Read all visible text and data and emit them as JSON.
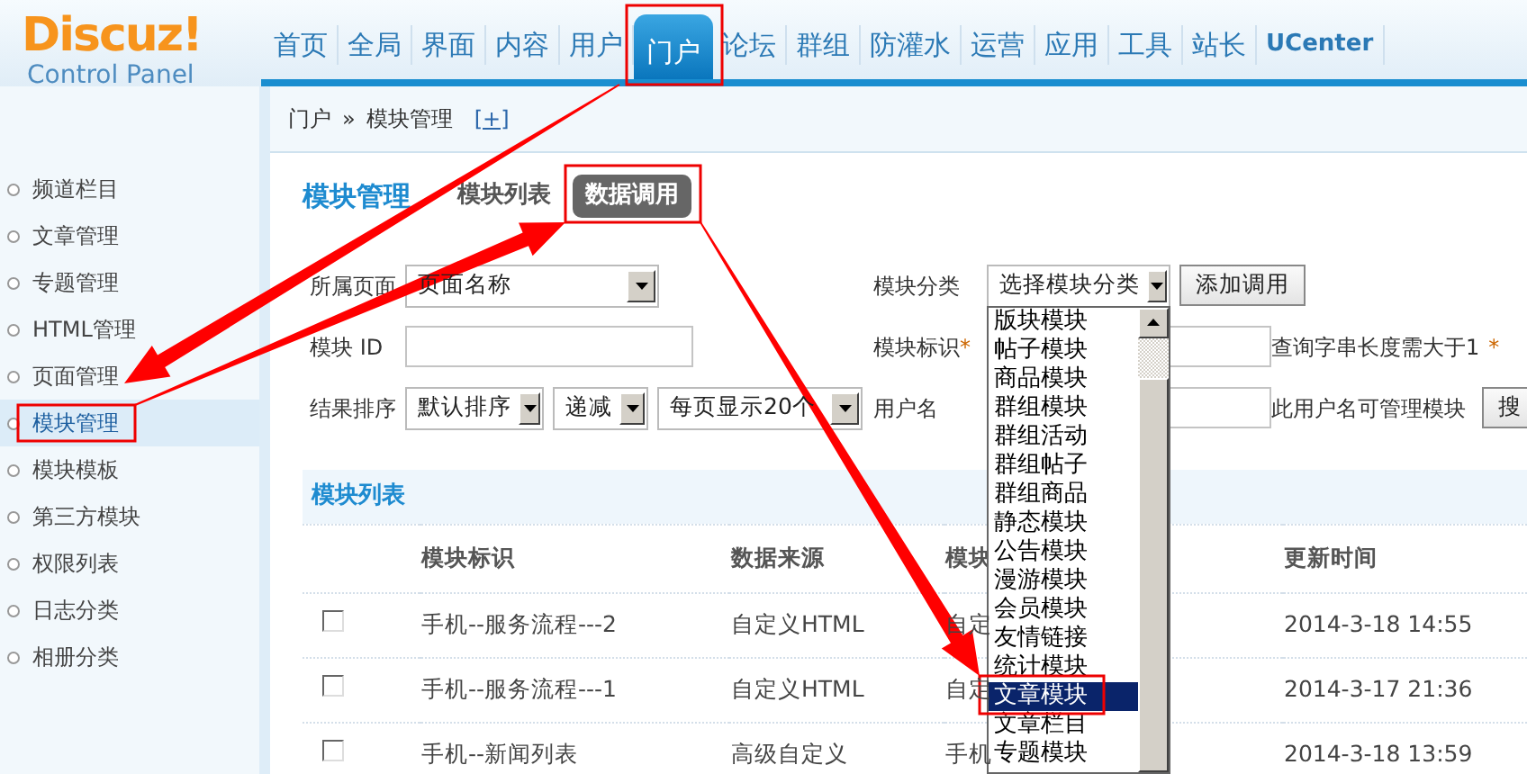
{
  "logo": {
    "name": "Discuz!",
    "subtitle": "Control Panel"
  },
  "nav_tabs": [
    {
      "label": "首页",
      "selected": false
    },
    {
      "label": "全局",
      "selected": false
    },
    {
      "label": "界面",
      "selected": false
    },
    {
      "label": "内容",
      "selected": false
    },
    {
      "label": "用户",
      "selected": false
    },
    {
      "label": "门户",
      "selected": true,
      "highlighted": true
    },
    {
      "label": "论坛",
      "selected": false
    },
    {
      "label": "群组",
      "selected": false
    },
    {
      "label": "防灌水",
      "selected": false
    },
    {
      "label": "运营",
      "selected": false
    },
    {
      "label": "应用",
      "selected": false
    },
    {
      "label": "工具",
      "selected": false
    },
    {
      "label": "站长",
      "selected": false
    },
    {
      "label": "UCenter",
      "selected": false,
      "kind": "bold"
    }
  ],
  "breadcrumb": {
    "items": [
      "门户",
      "模块管理"
    ],
    "separator": "»",
    "add_link": "[+]"
  },
  "sidebar": {
    "items": [
      {
        "label": "频道栏目",
        "selected": false
      },
      {
        "label": "文章管理",
        "selected": false
      },
      {
        "label": "专题管理",
        "selected": false
      },
      {
        "label": "HTML管理",
        "selected": false
      },
      {
        "label": "页面管理",
        "selected": false
      },
      {
        "label": "模块管理",
        "selected": true,
        "highlighted": true
      },
      {
        "label": "模块模板",
        "selected": false
      },
      {
        "label": "第三方模块",
        "selected": false
      },
      {
        "label": "权限列表",
        "selected": false
      },
      {
        "label": "日志分类",
        "selected": false
      },
      {
        "label": "相册分类",
        "selected": false
      }
    ]
  },
  "page": {
    "title": "模块管理",
    "tabs": [
      {
        "label": "模块列表",
        "selected": false
      },
      {
        "label": "数据调用",
        "selected": true,
        "highlighted": true
      }
    ]
  },
  "form": {
    "page_label": "所属页面",
    "page_select": "页面名称",
    "category_label": "模块分类",
    "category_select": "选择模块分类",
    "add_button": "添加调用",
    "id_label": "模块 ID",
    "mark_label": "模块标识",
    "required_mark": "*",
    "hint": "查询字串长度需大于1",
    "hint_mark": "*",
    "order_label": "结果排序",
    "order_select": "默认排序",
    "direction_select": "递减",
    "per_page_select": "每页显示20个",
    "user_label": "用户名",
    "user_hint": "此用户名可管理模块",
    "search_button": "搜"
  },
  "category_options": [
    {
      "label": "版块模块",
      "selected": false
    },
    {
      "label": "帖子模块",
      "selected": false
    },
    {
      "label": "商品模块",
      "selected": false
    },
    {
      "label": "群组模块",
      "selected": false
    },
    {
      "label": "群组活动",
      "selected": false
    },
    {
      "label": "群组帖子",
      "selected": false
    },
    {
      "label": "群组商品",
      "selected": false
    },
    {
      "label": "静态模块",
      "selected": false
    },
    {
      "label": "公告模块",
      "selected": false
    },
    {
      "label": "漫游模块",
      "selected": false
    },
    {
      "label": "会员模块",
      "selected": false
    },
    {
      "label": "友情链接",
      "selected": false
    },
    {
      "label": "统计模块",
      "selected": false
    },
    {
      "label": "文章模块",
      "selected": true,
      "highlighted": true
    },
    {
      "label": "文章栏目",
      "selected": false
    },
    {
      "label": "专题模块",
      "selected": false
    }
  ],
  "list": {
    "title": "模块列表",
    "columns": [
      "模块标识",
      "数据来源",
      "模块",
      "更新时间"
    ],
    "rows": [
      {
        "checked": false,
        "cells": [
          "手机--服务流程---2",
          "自定义HTML",
          "自定",
          "2014-3-18 14:55"
        ]
      },
      {
        "checked": false,
        "cells": [
          "手机--服务流程---1",
          "自定义HTML",
          "自定",
          "2014-3-17 21:36"
        ]
      },
      {
        "checked": false,
        "cells": [
          "手机--新闻列表",
          "高级自定义",
          "手机",
          "2014-3-18 13:59"
        ]
      }
    ]
  },
  "arrows": [
    {
      "kind": "tapered"
    },
    {
      "kind": "tapered"
    },
    {
      "kind": "tapered"
    }
  ]
}
